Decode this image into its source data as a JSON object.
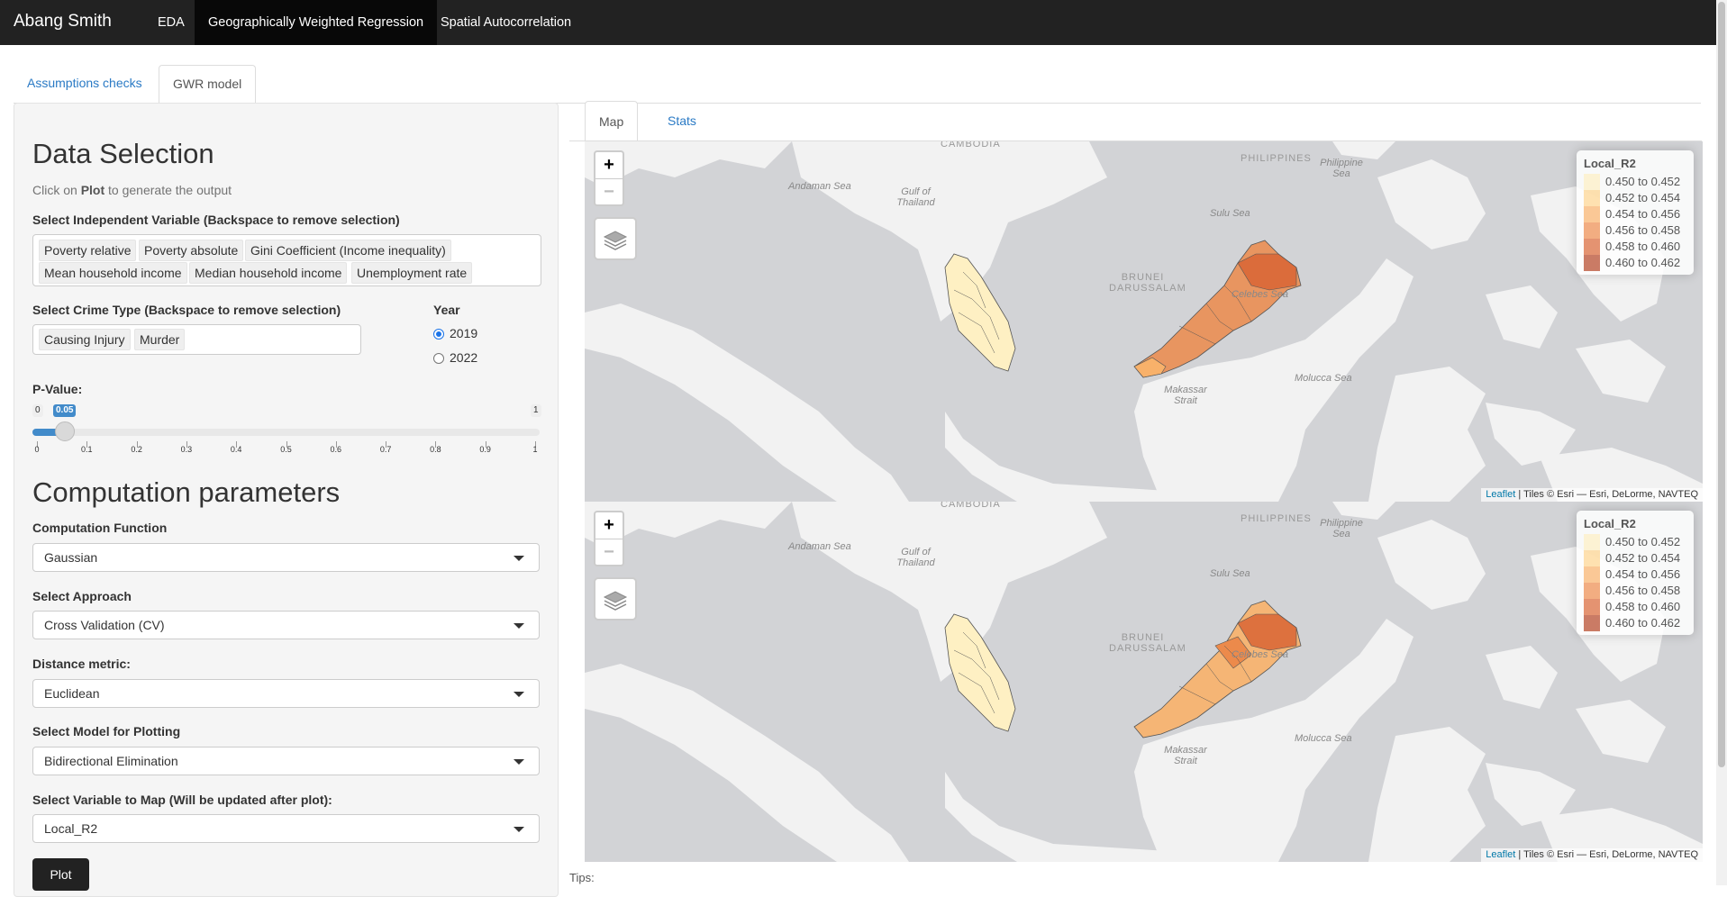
{
  "navbar": {
    "brand": "Abang Smith",
    "items": [
      "EDA",
      "Geographically Weighted Regression",
      "Spatial Autocorrelation"
    ],
    "active_index": 1
  },
  "tabs": {
    "items": [
      "Assumptions checks",
      "GWR model"
    ],
    "active_index": 1
  },
  "sidebar": {
    "data_selection_title": "Data Selection",
    "help_prefix": "Click on ",
    "help_bold": "Plot",
    "help_suffix": " to generate the output",
    "indep_label": "Select Independent Variable (Backspace to remove selection)",
    "indep_chips": [
      "Poverty relative",
      "Poverty absolute",
      "Gini Coefficient (Income inequality)",
      "Mean household income",
      "Median household income",
      "Unemployment rate"
    ],
    "crime_label": "Select Crime Type (Backspace to remove selection)",
    "crime_chips": [
      "Causing Injury",
      "Murder"
    ],
    "year_label": "Year",
    "year_options": [
      "2019",
      "2022"
    ],
    "year_selected": "2019",
    "pvalue_label": "P-Value:",
    "slider": {
      "min_label": "0",
      "max_label": "1",
      "value_label": "0.05",
      "ticks": [
        "0",
        "0.1",
        "0.2",
        "0.3",
        "0.4",
        "0.5",
        "0.6",
        "0.7",
        "0.8",
        "0.9",
        "1"
      ]
    },
    "computation_title": "Computation parameters",
    "fields": [
      {
        "label": "Computation Function",
        "value": "Gaussian"
      },
      {
        "label": "Select Approach",
        "value": "Cross Validation (CV)"
      },
      {
        "label": "Distance metric:",
        "value": "Euclidean"
      },
      {
        "label": "Select Model for Plotting",
        "value": "Bidirectional Elimination"
      },
      {
        "label": "Select Variable to Map (Will be updated after plot):",
        "value": "Local_R2"
      }
    ],
    "plot_button": "Plot"
  },
  "main_tabs": {
    "items": [
      "Map",
      "Stats"
    ],
    "active_index": 0
  },
  "maps": [
    {
      "zoom_in": "+",
      "zoom_out": "−",
      "legend_title": "Local_R2",
      "legend_items": [
        {
          "label": "0.450 to 0.452",
          "color": "#fef0c3"
        },
        {
          "label": "0.452 to 0.454",
          "color": "#fdd48e"
        },
        {
          "label": "0.454 to 0.456",
          "color": "#f8b16a"
        },
        {
          "label": "0.456 to 0.458",
          "color": "#ec8a4b"
        },
        {
          "label": "0.458 to 0.460",
          "color": "#d86535"
        },
        {
          "label": "0.460 to 0.462",
          "color": "#b44324"
        }
      ],
      "attribution_link": "Leaflet",
      "attribution_text": " | Tiles © Esri — Esri, DeLorme, NAVTEQ"
    },
    {
      "zoom_in": "+",
      "zoom_out": "−",
      "legend_title": "Local_R2",
      "legend_items": [
        {
          "label": "0.450 to 0.452",
          "color": "#fef0c3"
        },
        {
          "label": "0.452 to 0.454",
          "color": "#fdd48e"
        },
        {
          "label": "0.454 to 0.456",
          "color": "#f8b16a"
        },
        {
          "label": "0.456 to 0.458",
          "color": "#ec8a4b"
        },
        {
          "label": "0.458 to 0.460",
          "color": "#d86535"
        },
        {
          "label": "0.460 to 0.462",
          "color": "#b44324"
        }
      ],
      "attribution_link": "Leaflet",
      "attribution_text": " | Tiles © Esri — Esri, DeLorme, NAVTEQ"
    }
  ],
  "map_labels": [
    "CAMBODIA",
    "Andaman Sea",
    "Gulf of Thailand",
    "PHILIPPINES",
    "Philippine Sea",
    "Sulu Sea",
    "BRUNEI DARUSSALAM",
    "Celebes Sea",
    "Makassar Strait",
    "Molucca Sea"
  ],
  "tips_label": "Tips:"
}
